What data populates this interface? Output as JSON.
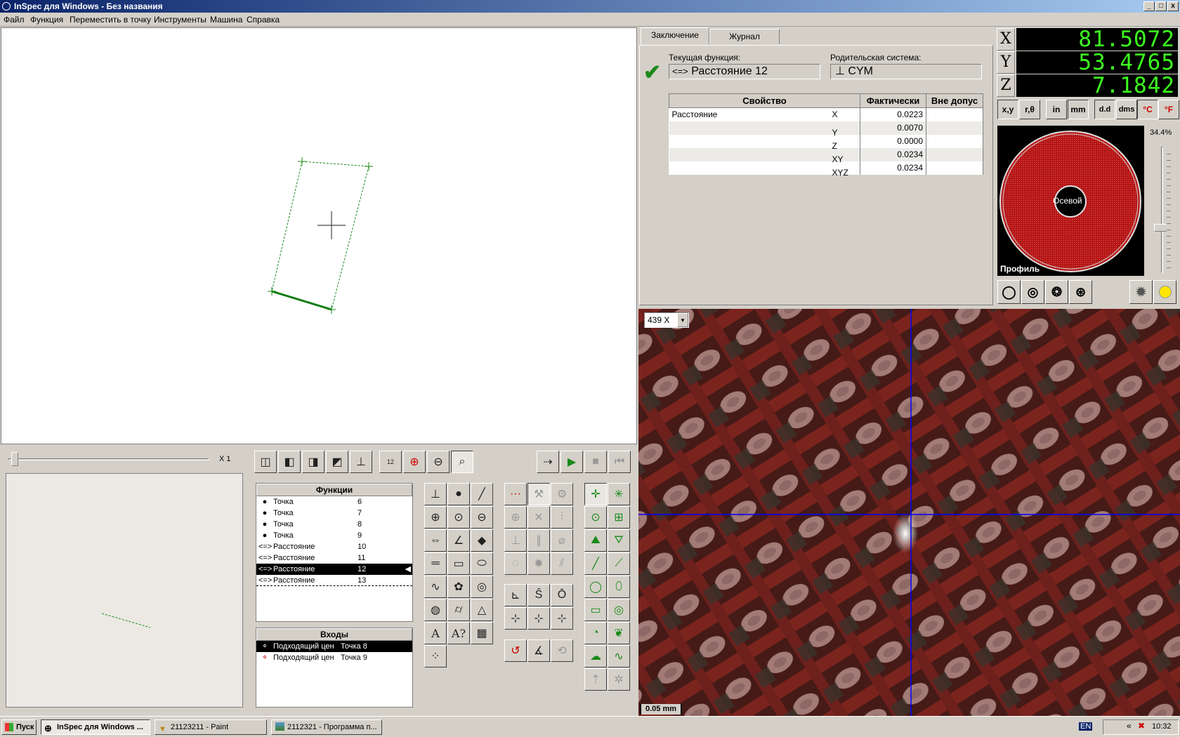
{
  "window": {
    "title": "InSpec для Windows - Без названия",
    "min": "_",
    "max": "□",
    "close": "x"
  },
  "menu": [
    "Файл",
    "Функция",
    "Переместить в точку",
    "Инструменты",
    "Машина",
    "Справка"
  ],
  "mini": {
    "zoom_label": "X 1"
  },
  "functions": {
    "header": "Функции",
    "rows": [
      {
        "icon": "●",
        "name": "Точка",
        "num": "6"
      },
      {
        "icon": "●",
        "name": "Точка",
        "num": "7"
      },
      {
        "icon": "●",
        "name": "Точка",
        "num": "8"
      },
      {
        "icon": "●",
        "name": "Точка",
        "num": "9"
      },
      {
        "icon": "<=>",
        "name": "Расстояние",
        "num": "10"
      },
      {
        "icon": "<=>",
        "name": "Расстояние",
        "num": "11"
      },
      {
        "icon": "<=>",
        "name": "Расстояние",
        "num": "12",
        "selected": true
      },
      {
        "icon": "<=>",
        "name": "Расстояние",
        "num": "13"
      }
    ]
  },
  "inputs": {
    "header": "Входы",
    "rows": [
      {
        "name": "Подходящий цен",
        "ref": "Точка 8",
        "selected": true
      },
      {
        "name": "Подходящий цен",
        "ref": "Точка 9"
      }
    ]
  },
  "toolbar": {
    "step_label": "12"
  },
  "report": {
    "tab_conclusion": "Заключение",
    "tab_journal": "Журнал",
    "current_label": "Текущая функция:",
    "current_value": "Расстояние  12",
    "current_icon": "<=>",
    "parent_label": "Родительская система:",
    "parent_value": "CYM",
    "table_headers": [
      "Свойство",
      "Фактически",
      "Вне допус"
    ],
    "rows": [
      {
        "property": "Расстояние",
        "axis": "X",
        "actual": "0.0223",
        "out": ""
      },
      {
        "property": "",
        "axis": "Y",
        "actual": "0.0070",
        "out": ""
      },
      {
        "property": "",
        "axis": "Z",
        "actual": "0.0000",
        "out": ""
      },
      {
        "property": "",
        "axis": "XY",
        "actual": "0.0234",
        "out": ""
      },
      {
        "property": "",
        "axis": "XYZ",
        "actual": "0.0234",
        "out": ""
      }
    ]
  },
  "readout": {
    "x_label": "X",
    "x_value": "81.5072",
    "y_label": "Y",
    "y_value": "53.4765",
    "z_label": "Z",
    "z_value": "7.1842",
    "btn_xy": "x,y",
    "btn_rtheta": "r,θ",
    "btn_in": "in",
    "btn_mm": "mm",
    "btn_dd": "d.d",
    "btn_dms": "dms",
    "btn_c": "°C",
    "btn_f": "°F",
    "light_percent": "34.4%",
    "ring_center_label": "Осевой",
    "ring_bottom_label": "Профиль",
    "colors": {
      "ring": "#b31414",
      "digits": "#3cff1e"
    }
  },
  "camera": {
    "zoom_value": "439 X",
    "scale_label": "0.05 mm"
  },
  "taskbar": {
    "start": "Пуск",
    "tasks": [
      "InSpec для Windows ...",
      "21123211 - Paint",
      "2112321 - Программа п..."
    ],
    "lang": "EN",
    "clock": "10:32"
  }
}
